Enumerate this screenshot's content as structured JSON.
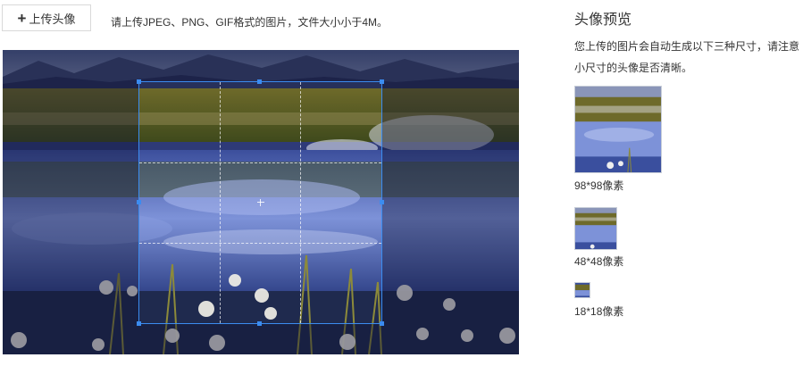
{
  "upload": {
    "button_label": "上传头像",
    "hint": "请上传JPEG、PNG、GIF格式的图片，文件大小小于4M。"
  },
  "preview_panel": {
    "title": "头像预览",
    "description": "您上传的图片会自动生成以下三种尺寸，请注意小尺寸的头像是否清晰。",
    "sizes": [
      {
        "label": "98*98像素"
      },
      {
        "label": "48*48像素"
      },
      {
        "label": "18*18像素"
      }
    ]
  },
  "colors": {
    "crop_border": "#3b8cf0",
    "button_border": "#d9d9d9",
    "text": "#333333"
  }
}
